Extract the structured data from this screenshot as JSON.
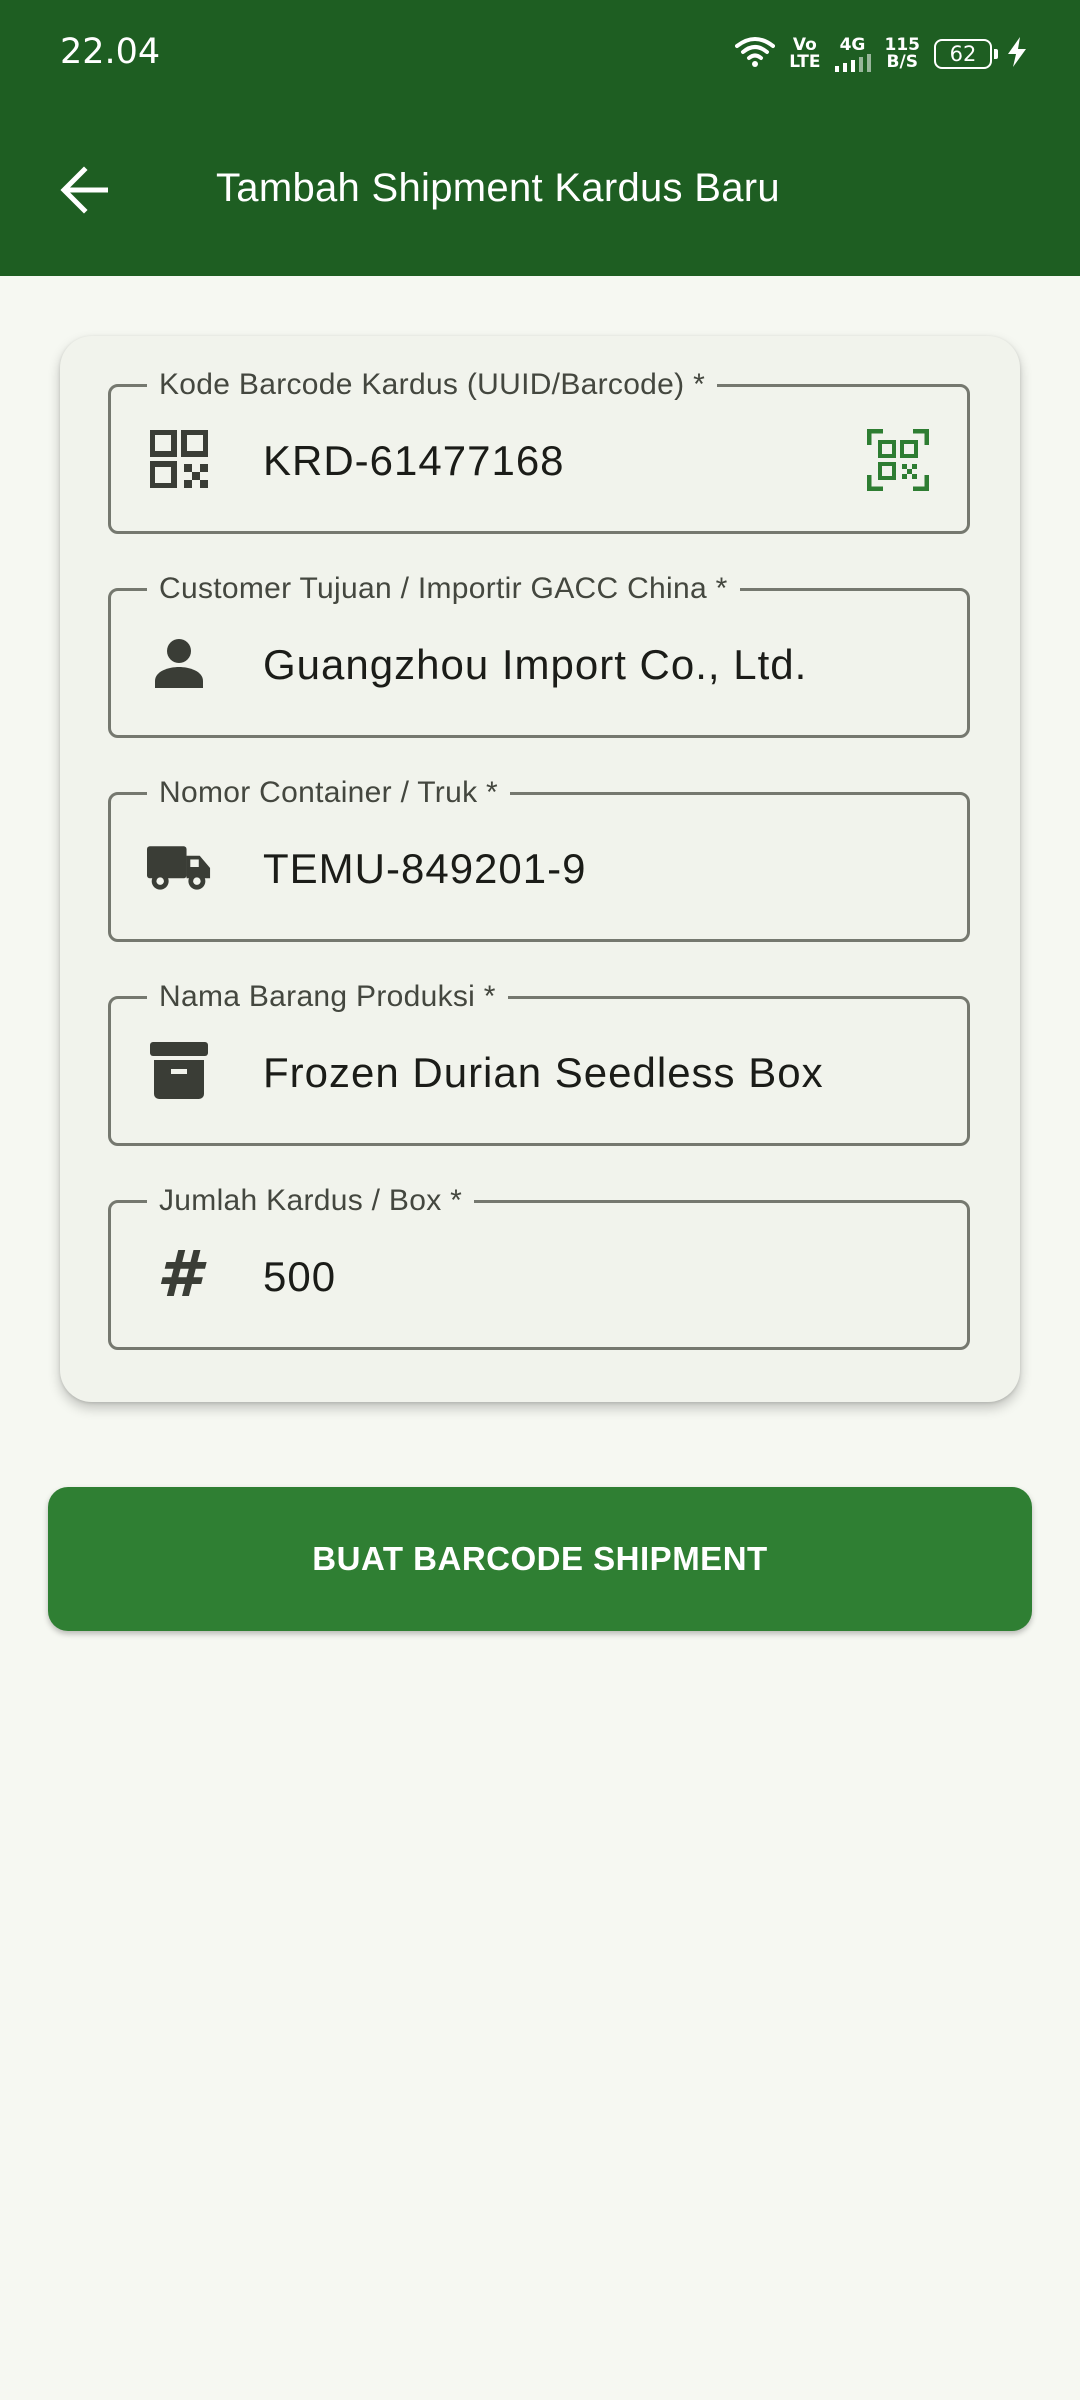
{
  "status_bar": {
    "time": "22.04",
    "volte_top": "Vo",
    "volte_bottom": "LTE",
    "network": "4G",
    "speed_value": "115",
    "speed_unit": "B/S",
    "battery": "62"
  },
  "appbar": {
    "title": "Tambah Shipment Kardus Baru",
    "back_icon": "arrow-back-icon"
  },
  "form": {
    "fields": [
      {
        "label": "Kode Barcode Kardus (UUID/Barcode) *",
        "value": "KRD-61477168",
        "icon": "qr-code-icon",
        "trailing_icon": "qr-scan-icon"
      },
      {
        "label": "Customer Tujuan / Importir GACC China *",
        "value": "Guangzhou Import Co., Ltd.",
        "icon": "person-icon"
      },
      {
        "label": "Nomor Container / Truk *",
        "value": "TEMU-849201-9",
        "icon": "truck-icon"
      },
      {
        "label": "Nama Barang Produksi *",
        "value": "Frozen Durian Seedless Box",
        "icon": "archive-box-icon"
      },
      {
        "label": "Jumlah Kardus / Box *",
        "value": "500",
        "icon": "hash-icon",
        "icon_glyph": "#"
      }
    ]
  },
  "submit_button": {
    "label": "BUAT BARCODE SHIPMENT"
  },
  "colors": {
    "appbar": "#1e5e22",
    "button": "#2f7f33",
    "accent_icon": "#2e7d32",
    "background": "#f6f8f2",
    "card": "#f1f3ec"
  }
}
